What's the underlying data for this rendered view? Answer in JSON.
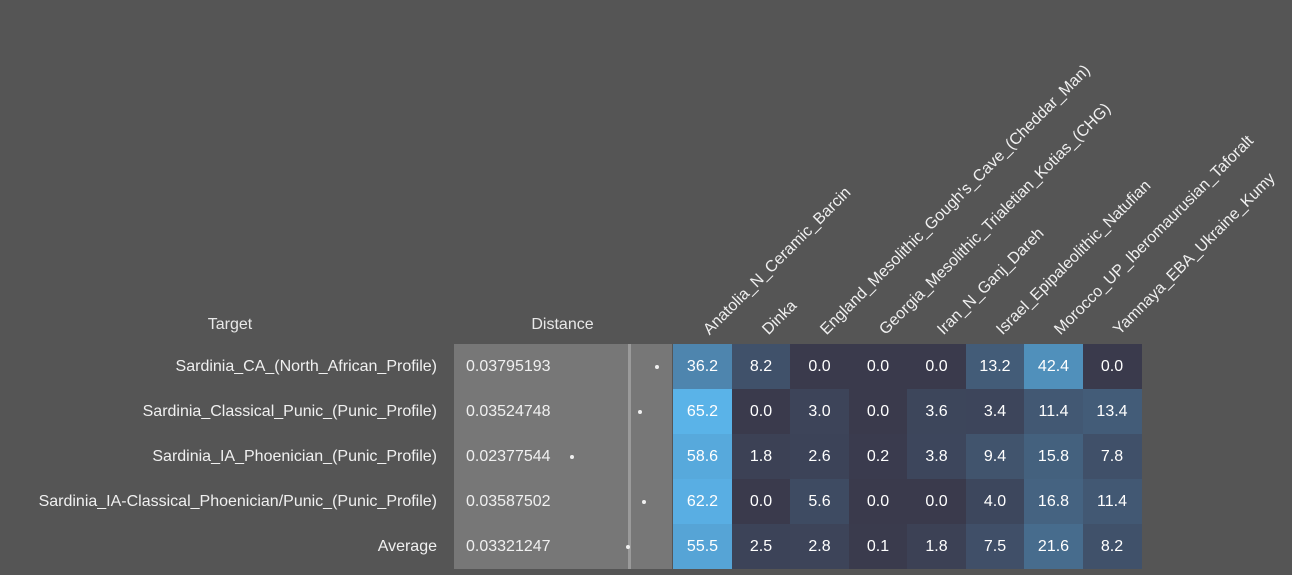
{
  "headers": {
    "target": "Target",
    "distance": "Distance"
  },
  "populations": [
    "Anatolia_N_Ceramic_Barcin",
    "Dinka",
    "England_Mesolithic_Gough's_Cave_(Cheddar_Man)",
    "Georgia_Mesolithic_Trialetian_Kotias_(CHG)",
    "Iran_N_Ganj_Dareh",
    "Israel_Epipaleolithic_Natufian",
    "Morocco_UP_Iberomaurusian_Taforalt",
    "Yamnaya_EBA_Ukraine_Kumy"
  ],
  "rows": [
    {
      "target": "Sardinia_CA_(North_African_Profile)",
      "distance": "0.03795193",
      "distance_value": 0.03795193,
      "values": [
        "36.2",
        "8.2",
        "0.0",
        "0.0",
        "0.0",
        "13.2",
        "42.4",
        "0.0"
      ]
    },
    {
      "target": "Sardinia_Classical_Punic_(Punic_Profile)",
      "distance": "0.03524748",
      "distance_value": 0.03524748,
      "values": [
        "65.2",
        "0.0",
        "3.0",
        "0.0",
        "3.6",
        "3.4",
        "11.4",
        "13.4"
      ]
    },
    {
      "target": "Sardinia_IA_Phoenician_(Punic_Profile)",
      "distance": "0.02377544",
      "distance_value": 0.02377544,
      "values": [
        "58.6",
        "1.8",
        "2.6",
        "0.2",
        "3.8",
        "9.4",
        "15.8",
        "7.8"
      ]
    },
    {
      "target": "Sardinia_IA-Classical_Phoenician/Punic_(Punic_Profile)",
      "distance": "0.03587502",
      "distance_value": 0.03587502,
      "values": [
        "62.2",
        "0.0",
        "5.6",
        "0.0",
        "0.0",
        "4.0",
        "16.8",
        "11.4"
      ]
    },
    {
      "target": "Average",
      "distance": "0.03321247",
      "distance_value": 0.03321247,
      "values": [
        "55.5",
        "2.5",
        "2.8",
        "0.1",
        "1.8",
        "7.5",
        "21.6",
        "8.2"
      ]
    }
  ],
  "colors": {
    "background": "#555555",
    "distance_panel": "#777777",
    "heat_low": "#3a3a4c",
    "heat_high": "#5ab4ea"
  }
}
